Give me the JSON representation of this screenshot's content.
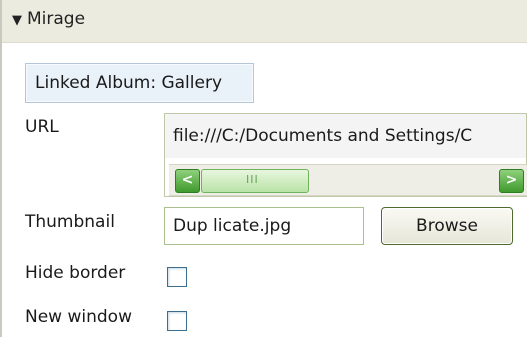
{
  "panel": {
    "expand_icon": "triangle-down-icon",
    "title": "Mirage"
  },
  "linked_album": {
    "label": "Linked Album: Gallery"
  },
  "url": {
    "label": "URL",
    "value": "file:///C:/Documents and Settings/C",
    "scroll_left_icon": "arrow-left-icon",
    "scroll_right_icon": "arrow-right-icon"
  },
  "thumbnail": {
    "label": "Thumbnail",
    "value": "Dup licate.jpg",
    "browse_label": "Browse"
  },
  "hide_border": {
    "label": "Hide border",
    "checked": false
  },
  "new_window": {
    "label": "New window",
    "checked": false
  },
  "colors": {
    "header_bg": "#ebebdf",
    "linked_bg": "#e9f1f9",
    "scroll_green": "#3f9a2e"
  }
}
